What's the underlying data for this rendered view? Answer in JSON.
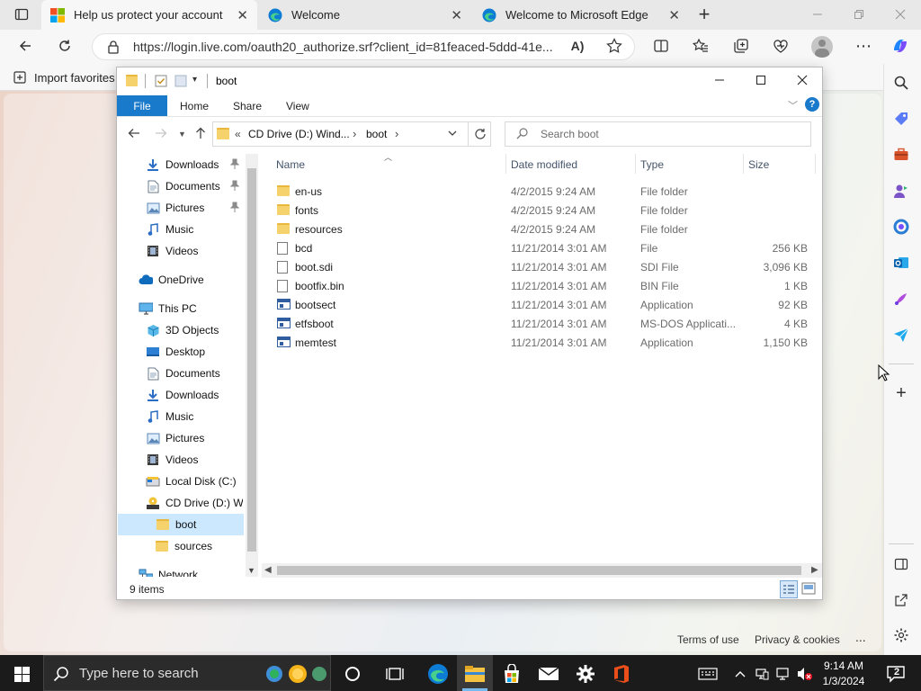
{
  "browser": {
    "tabs": [
      {
        "title": "Help us protect your account",
        "active": true
      },
      {
        "title": "Welcome",
        "active": false
      },
      {
        "title": "Welcome to Microsoft Edge",
        "active": false
      }
    ],
    "url": "https://login.live.com/oauth20_authorize.srf?client_id=81feaced-5ddd-41e...",
    "favorites_import": "Import favorites",
    "new_tab_symbol": "+",
    "read_aloud_label": "A)"
  },
  "page": {
    "footer_terms": "Terms of use",
    "footer_privacy": "Privacy & cookies",
    "footer_more": "..."
  },
  "explorer": {
    "title": "boot",
    "ribbon_tabs": [
      "File",
      "Home",
      "Share",
      "View"
    ],
    "address": {
      "prefix": "«",
      "segment1": "CD Drive (D:) Wind...",
      "sep1": "›",
      "segment2": "boot",
      "sep2": "›"
    },
    "search_placeholder": "Search boot",
    "tree": [
      {
        "label": "Downloads",
        "icon": "download-arrow-icon",
        "pinned": true,
        "indent": 1
      },
      {
        "label": "Documents",
        "icon": "document-icon",
        "pinned": true,
        "indent": 1
      },
      {
        "label": "Pictures",
        "icon": "picture-icon",
        "pinned": true,
        "indent": 1
      },
      {
        "label": "Music",
        "icon": "music-note-icon",
        "pinned": false,
        "indent": 1
      },
      {
        "label": "Videos",
        "icon": "film-icon",
        "pinned": false,
        "indent": 1
      },
      {
        "label": "OneDrive",
        "icon": "cloud-icon",
        "pinned": false,
        "indent": 0
      },
      {
        "label": "This PC",
        "icon": "monitor-icon",
        "pinned": false,
        "indent": 0
      },
      {
        "label": "3D Objects",
        "icon": "cube-icon",
        "pinned": false,
        "indent": 1
      },
      {
        "label": "Desktop",
        "icon": "desktop-icon",
        "pinned": false,
        "indent": 1
      },
      {
        "label": "Documents",
        "icon": "document-icon",
        "pinned": false,
        "indent": 1
      },
      {
        "label": "Downloads",
        "icon": "download-arrow-icon",
        "pinned": false,
        "indent": 1
      },
      {
        "label": "Music",
        "icon": "music-note-icon",
        "pinned": false,
        "indent": 1
      },
      {
        "label": "Pictures",
        "icon": "picture-icon",
        "pinned": false,
        "indent": 1
      },
      {
        "label": "Videos",
        "icon": "film-icon",
        "pinned": false,
        "indent": 1
      },
      {
        "label": "Local Disk (C:)",
        "icon": "drive-icon",
        "pinned": false,
        "indent": 1
      },
      {
        "label": "CD Drive (D:) Wi",
        "icon": "cd-drive-icon",
        "pinned": false,
        "indent": 1
      },
      {
        "label": "boot",
        "icon": "folder-icon",
        "pinned": false,
        "indent": 2,
        "selected": true
      },
      {
        "label": "sources",
        "icon": "folder-icon",
        "pinned": false,
        "indent": 2
      },
      {
        "label": "Network",
        "icon": "network-icon",
        "pinned": false,
        "indent": 0
      }
    ],
    "columns": {
      "name": "Name",
      "date": "Date modified",
      "type": "Type",
      "size": "Size"
    },
    "files": [
      {
        "name": "en-us",
        "date": "4/2/2015 9:24 AM",
        "type": "File folder",
        "size": "",
        "icon": "folder-icon"
      },
      {
        "name": "fonts",
        "date": "4/2/2015 9:24 AM",
        "type": "File folder",
        "size": "",
        "icon": "folder-icon"
      },
      {
        "name": "resources",
        "date": "4/2/2015 9:24 AM",
        "type": "File folder",
        "size": "",
        "icon": "folder-icon"
      },
      {
        "name": "bcd",
        "date": "11/21/2014 3:01 AM",
        "type": "File",
        "size": "256 KB",
        "icon": "file-icon"
      },
      {
        "name": "boot.sdi",
        "date": "11/21/2014 3:01 AM",
        "type": "SDI File",
        "size": "3,096 KB",
        "icon": "file-icon"
      },
      {
        "name": "bootfix.bin",
        "date": "11/21/2014 3:01 AM",
        "type": "BIN File",
        "size": "1 KB",
        "icon": "file-icon"
      },
      {
        "name": "bootsect",
        "date": "11/21/2014 3:01 AM",
        "type": "Application",
        "size": "92 KB",
        "icon": "application-icon"
      },
      {
        "name": "etfsboot",
        "date": "11/21/2014 3:01 AM",
        "type": "MS-DOS Applicati...",
        "size": "4 KB",
        "icon": "application-icon"
      },
      {
        "name": "memtest",
        "date": "11/21/2014 3:01 AM",
        "type": "Application",
        "size": "1,150 KB",
        "icon": "application-icon"
      }
    ],
    "status": "9 items"
  },
  "taskbar": {
    "search_placeholder": "Type here to search",
    "time": "9:14 AM",
    "date": "1/3/2024",
    "notification_count": "2"
  }
}
